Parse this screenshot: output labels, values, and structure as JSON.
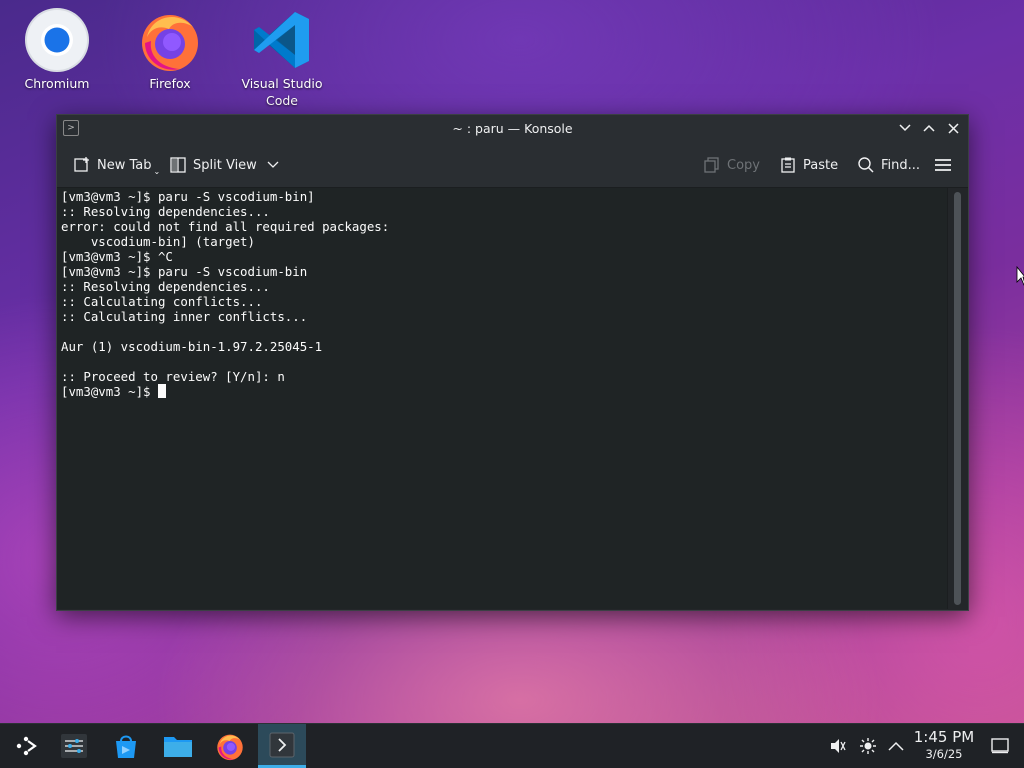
{
  "desktop": {
    "icons": [
      {
        "label": "Chromium"
      },
      {
        "label": "Firefox"
      },
      {
        "label": "Visual Studio Code"
      }
    ]
  },
  "window": {
    "title": "~ : paru — Konsole",
    "toolbar": {
      "new_tab": "New Tab",
      "split_view": "Split View",
      "copy": "Copy",
      "paste": "Paste",
      "find": "Find..."
    },
    "terminal": {
      "lines": [
        "[vm3@vm3 ~]$ paru -S vscodium-bin]",
        ":: Resolving dependencies...",
        "error: could not find all required packages:",
        "    vscodium-bin] (target)",
        "[vm3@vm3 ~]$ ^C",
        "[vm3@vm3 ~]$ paru -S vscodium-bin",
        ":: Resolving dependencies...",
        ":: Calculating conflicts...",
        ":: Calculating inner conflicts...",
        "",
        "Aur (1) vscodium-bin-1.97.2.25045-1",
        "",
        ":: Proceed to review? [Y/n]: n",
        "[vm3@vm3 ~]$ "
      ]
    }
  },
  "taskbar": {
    "clock": {
      "time": "1:45 PM",
      "date": "3/6/25"
    }
  },
  "colors": {
    "terminal_bg": "#1f2425",
    "terminal_fg": "#fcfcfc",
    "accent": "#3daee9",
    "panel_bg": "#1f2226"
  }
}
